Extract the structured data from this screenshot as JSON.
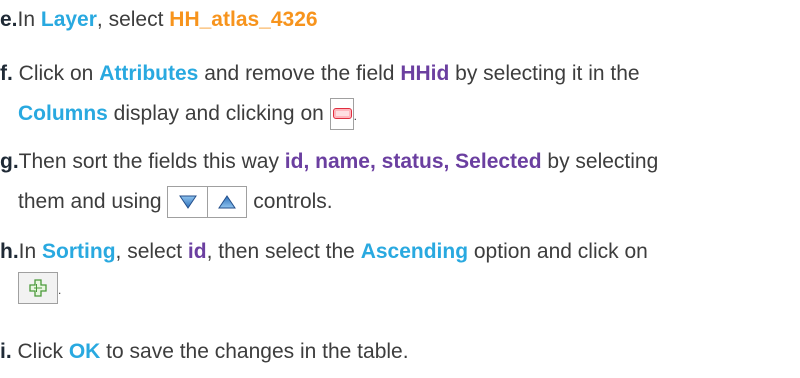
{
  "steps": {
    "e": {
      "letter": "e.",
      "t1": "In ",
      "k1": "Layer",
      "t2": ", select ",
      "k2": "HH_atlas_4326"
    },
    "f": {
      "letter": "f.",
      "t1": " Click on ",
      "k1": "Attributes",
      "t2": " and remove the field ",
      "k2": "HHid",
      "t3": " by selecting it in the",
      "k3": "Columns",
      "t4": " display and clicking on ",
      "t5": "."
    },
    "g": {
      "letter": "g.",
      "t1": "Then sort the fields this way ",
      "k1": "id, name, status, Selected",
      "t2": " by selecting",
      "t3": "them and using ",
      "t4": " controls."
    },
    "h": {
      "letter": "h.",
      "t1": "In ",
      "k1": "Sorting",
      "t2": ", select ",
      "k2": "id",
      "t3": ", then select the ",
      "k3": "Ascending",
      "t4": " option and click on",
      "t5": "."
    },
    "i": {
      "letter": "i.",
      "t1": " Click ",
      "k1": "OK",
      "t2": " to save the changes in the table."
    }
  },
  "icons": {
    "remove": "remove-field-icon",
    "move_down": "arrow-down-icon",
    "move_up": "arrow-up-icon",
    "add": "add-sort-icon"
  },
  "colors": {
    "blue": "#29a9e0",
    "orange": "#f7941d",
    "purple": "#6b3fa0",
    "text": "#3d3d3d"
  }
}
